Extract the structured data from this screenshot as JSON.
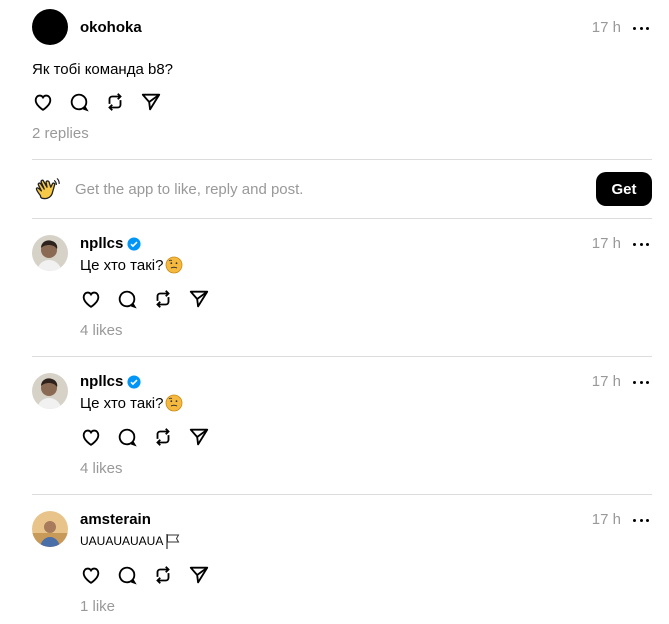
{
  "main_post": {
    "username": "okohoka",
    "time": "17 h",
    "text": "Як тобі команда b8?",
    "replies": "2 replies"
  },
  "cta": {
    "text": "Get the app to like, reply and post.",
    "button": "Get"
  },
  "replies": [
    {
      "username": "npllcs",
      "verified": true,
      "time": "17 h",
      "text": "Це хто такі?",
      "likes": "4 likes"
    },
    {
      "username": "npllcs",
      "verified": true,
      "time": "17 h",
      "text": "Це хто такі?",
      "likes": "4 likes"
    },
    {
      "username": "amsterain",
      "verified": false,
      "time": "17 h",
      "text": "UAUAUAUAUA",
      "likes": "1 like"
    }
  ],
  "colors": {
    "verified_blue": "#0095f6",
    "muted": "#999999",
    "button_bg": "#000000"
  }
}
